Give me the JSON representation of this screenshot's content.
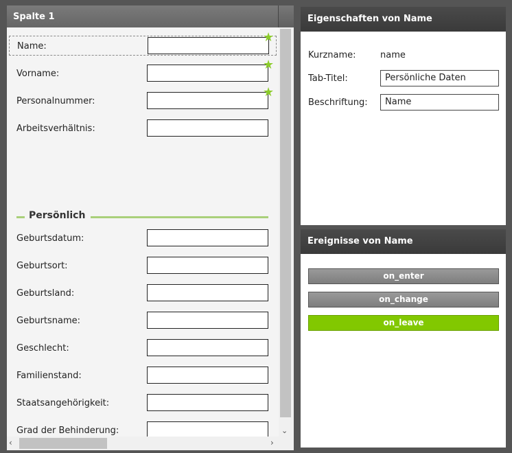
{
  "column": {
    "title": "Spalte 1",
    "fields_top": [
      {
        "label": "Name:",
        "value": ""
      },
      {
        "label": "Vorname:",
        "value": ""
      },
      {
        "label": "Personalnummer:",
        "value": ""
      },
      {
        "label": "Arbeitsverhältnis:",
        "value": ""
      }
    ],
    "section_title": "Persönlich",
    "fields_personal": [
      {
        "label": "Geburtsdatum:",
        "value": ""
      },
      {
        "label": "Geburtsort:",
        "value": ""
      },
      {
        "label": "Geburtsland:",
        "value": ""
      },
      {
        "label": "Geburtsname:",
        "value": ""
      },
      {
        "label": "Geschlecht:",
        "value": ""
      },
      {
        "label": "Familienstand:",
        "value": ""
      },
      {
        "label": "Staatsangehörigkeit:",
        "value": ""
      },
      {
        "label": "Grad der Behinderung:",
        "value": ""
      }
    ],
    "star_icon": "★"
  },
  "properties": {
    "title": "Eigenschaften von Name",
    "shortname_label": "Kurzname:",
    "shortname_value": "name",
    "tabtitle_label": "Tab-Titel:",
    "tabtitle_value": "Persönliche Daten",
    "caption_label": "Beschriftung:",
    "caption_value": "Name"
  },
  "events": {
    "title": "Ereignisse von Name",
    "on_enter": "on_enter",
    "on_change": "on_change",
    "on_leave": "on_leave"
  },
  "scroll": {
    "up_arrow": "▲",
    "down_arrow": "⌄",
    "left_arrow": "‹",
    "right_arrow": "›"
  },
  "colors": {
    "accent_green": "#82c800",
    "star_green": "#8ccc2a",
    "section_line": "#a9d07a"
  }
}
